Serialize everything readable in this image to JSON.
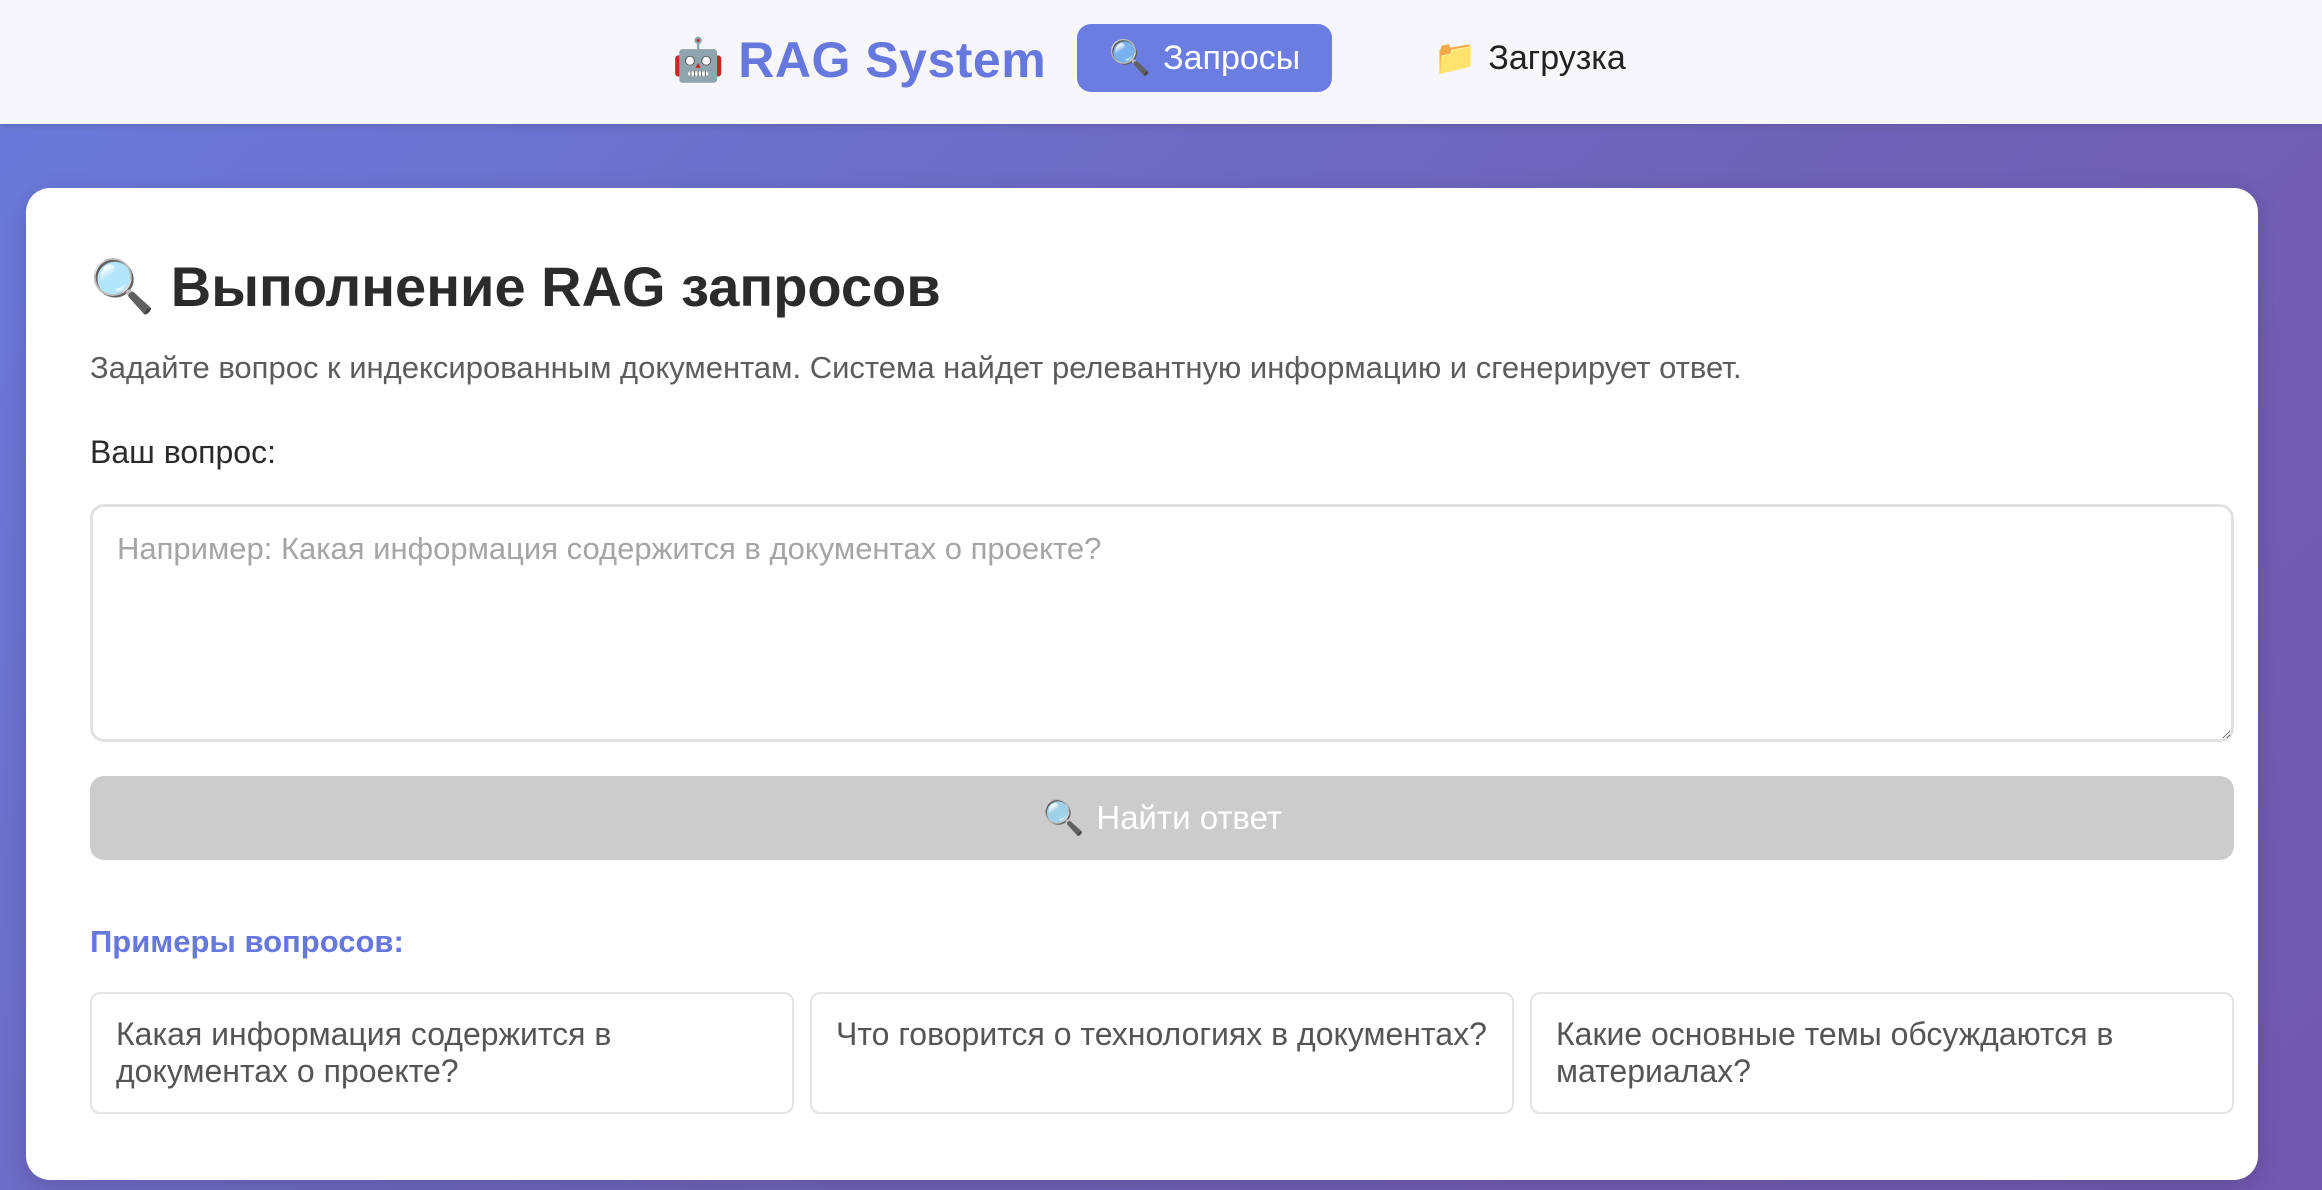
{
  "header": {
    "brand_icon": "robot-icon",
    "brand_icon_glyph": "🤖",
    "brand_title": "RAG System",
    "tabs": [
      {
        "label": "Запросы",
        "icon": "magnifier-icon",
        "glyph": "🔍",
        "active": true
      },
      {
        "label": "Загрузка",
        "icon": "folder-icon",
        "glyph": "📁",
        "active": false
      }
    ]
  },
  "main": {
    "title_icon_glyph": "🔍",
    "title": "Выполнение RAG запросов",
    "description": "Задайте вопрос к индексированным документам. Система найдет релевантную информацию и сгенерирует ответ.",
    "question_label": "Ваш вопрос:",
    "question_value": "",
    "question_placeholder": "Например: Какая информация содержится в документах о проекте?",
    "submit_icon_glyph": "🔍",
    "submit_label": "Найти ответ",
    "submit_disabled": true,
    "examples_title": "Примеры вопросов:",
    "examples": [
      "Какая информация содержится в документах о проекте?",
      "Что говорится о технологиях в документах?",
      "Какие основные темы обсуждаются в материалах?"
    ]
  },
  "colors": {
    "accent": "#6677dd",
    "active_tab_bg": "#6b7de0",
    "disabled_button_bg": "#cccccc",
    "background_gradient_start": "#6a7bdc",
    "background_gradient_end": "#7158b0"
  }
}
